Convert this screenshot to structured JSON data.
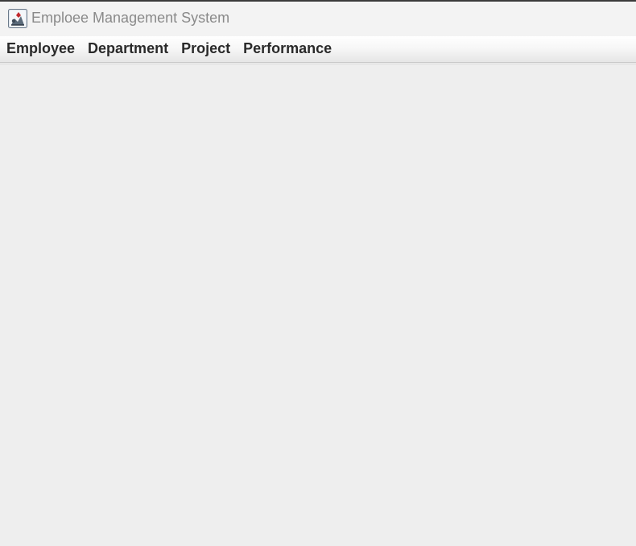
{
  "window": {
    "title": "Emploee Management System",
    "icon": "java-app-icon"
  },
  "menubar": {
    "items": [
      {
        "label": "Employee"
      },
      {
        "label": "Department"
      },
      {
        "label": "Project"
      },
      {
        "label": "Performance"
      }
    ]
  },
  "colors": {
    "background": "#eeeeee",
    "titlebar": "#f3f3f3",
    "title_text": "#8a8a8a",
    "menu_text": "#2a2a2a"
  }
}
